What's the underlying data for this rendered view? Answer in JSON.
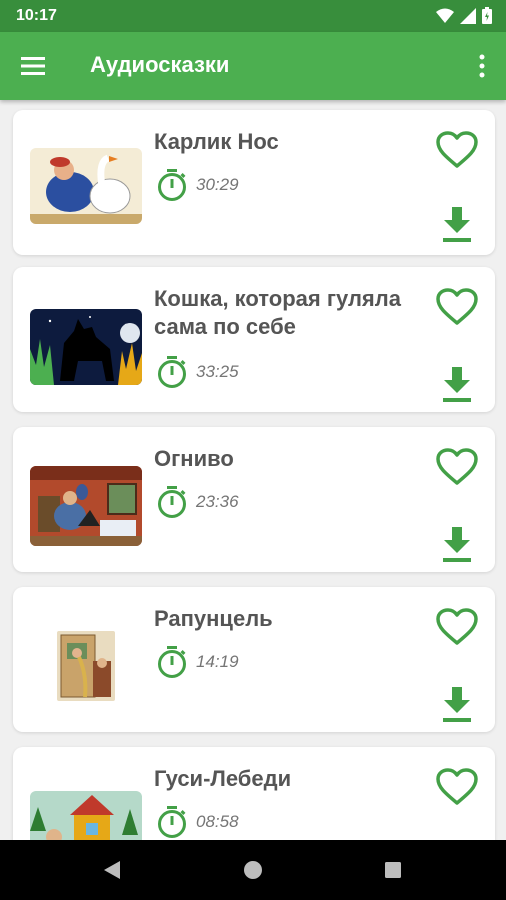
{
  "status_bar": {
    "time": "10:17"
  },
  "app_bar": {
    "title": "Аудиосказки"
  },
  "colors": {
    "accent": "#4caf50",
    "status": "#388e3c",
    "icon_green": "#43a047"
  },
  "stories": [
    {
      "title": "Карлик Нос",
      "duration": "30:29",
      "thumb": "dwarf-goose-illustration"
    },
    {
      "title": "Кошка, которая гуляла сама по себе",
      "duration": "33:25",
      "thumb": "black-cat-night-illustration"
    },
    {
      "title": "Огниво",
      "duration": "23:36",
      "thumb": "tinderbox-room-illustration"
    },
    {
      "title": "Рапунцель",
      "duration": "14:19",
      "thumb": "rapunzel-tower-illustration"
    },
    {
      "title": "Гуси-Лебеди",
      "duration": "08:58",
      "thumb": "geese-swans-house-illustration"
    }
  ]
}
